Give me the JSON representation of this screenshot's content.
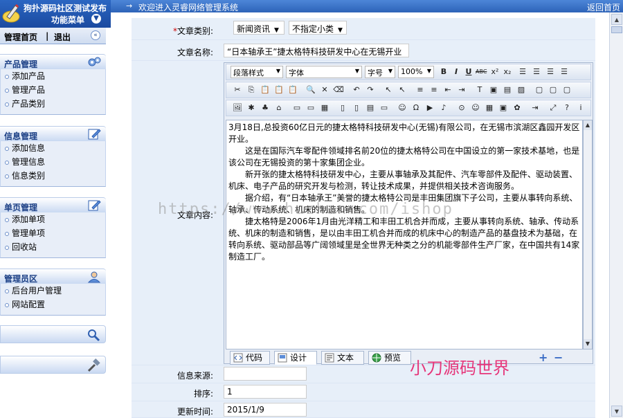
{
  "sidebar": {
    "site_title": "狗扑源码社区测试发布",
    "menu_title": "功能菜单",
    "menu_toggle_symbol": "▼",
    "nav_home": "管理首页",
    "nav_separator": "|",
    "nav_logout": "退出",
    "collapse_symbol": "«",
    "groups": [
      {
        "title": "产品管理",
        "icon": "gears-icon",
        "items": [
          "添加产品",
          "管理产品",
          "产品类别"
        ]
      },
      {
        "title": "信息管理",
        "icon": "edit-icon",
        "items": [
          "添加信息",
          "管理信息",
          "信息类别"
        ]
      },
      {
        "title": "单页管理",
        "icon": "edit-icon",
        "items": [
          "添加单项",
          "管理单项",
          "回收站"
        ]
      },
      {
        "title": "管理员区",
        "icon": "user-icon",
        "items": [
          "后台用户管理",
          "网站配置"
        ]
      }
    ]
  },
  "topbar": {
    "arrow": "→",
    "welcome": "欢迎进入灵睿网络管理系统",
    "back_home": "返回首页"
  },
  "form": {
    "category_label": "*文章类别:",
    "category_required_mark": "*",
    "category_label_text": "文章类别:",
    "category_value": "新闻资讯",
    "subcategory_value": "不指定小类",
    "title_label": "文章名称:",
    "title_value": "“日本轴承王”捷太格特科技研发中心在无锡开业",
    "content_label": "文章内容:",
    "source_label": "信息来源:",
    "source_value": "",
    "order_label": "排序:",
    "order_value": "1",
    "time_label": "更新时间:",
    "time_value": "2015/1/9"
  },
  "editor": {
    "paragraph_style": "段落样式",
    "font": "字体",
    "font_size": "字号",
    "zoom": "100%",
    "tabs": {
      "code": "代码",
      "design": "设计",
      "text": "文本",
      "preview": "预览"
    },
    "paragraphs": [
      "3月18日,总投资60亿日元的捷太格特科技研发中心(无锡)有限公司，在无锡市滨湖区鑫园开发区开业。",
      "这是在国际汽车零配件领域排名前20位的捷太格特公司在中国设立的第一家技术基地，也是该公司在无锡投资的第十家集团企业。",
      "新开张的捷太格特科技研发中心，主要从事轴承及其配件、汽车零部件及配件、驱动装置、机床、电子产品的研究开发与检测，转让技术成果，并提供相关技术咨询服务。",
      "据介绍，有“日本轴承王”美誉的捷太格特公司是丰田集团旗下子公司，主要从事转向系统、轴承、传动系统、机床的制造和销售。",
      "捷太格特是2006年1月由光洋精工和丰田工机合并而成，主要从事转向系统、轴承、传动系统、机床的制造和销售，是以由丰田工机合并而成的机床中心的制造产品的基盘技术为基础，在转向系统、驱动部品等广阔领域里是全世界无种类之分的机能零部件生产厂家，在中国共有14家制造工厂。"
    ]
  },
  "watermarks": {
    "brand": "小刀源码世界",
    "url": "https://www.huzhan.com/ishop"
  },
  "colors": {
    "topbar": "#2d63b8",
    "form_bg": "#e7eff9",
    "required": "#cc0000",
    "watermark": "#e6367a"
  }
}
